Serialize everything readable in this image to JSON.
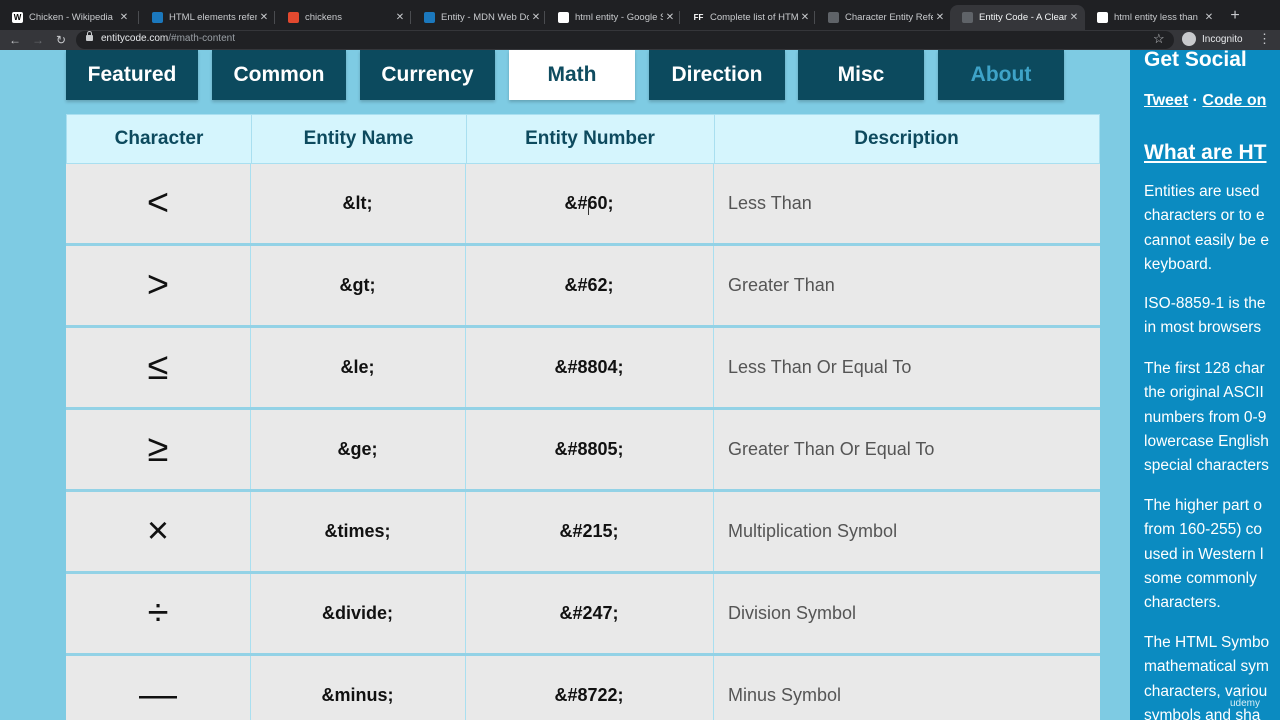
{
  "browser": {
    "tabs": [
      {
        "title": "Chicken - Wikipedia",
        "favicon": "W",
        "favicon_bg": "#ffffff",
        "favicon_color": "#000000",
        "active": false
      },
      {
        "title": "HTML elements reference",
        "favicon": "",
        "favicon_bg": "#1b78bd",
        "favicon_color": "#ffffff",
        "active": false
      },
      {
        "title": "chickens",
        "favicon": "",
        "favicon_bg": "#e2492f",
        "favicon_color": "#ffffff",
        "active": false
      },
      {
        "title": "Entity - MDN Web Docs",
        "favicon": "",
        "favicon_bg": "#1b78bd",
        "favicon_color": "#ffffff",
        "active": false
      },
      {
        "title": "html entity - Google Search",
        "favicon": "",
        "favicon_bg": "#ffffff",
        "favicon_color": "#4285f4",
        "active": false
      },
      {
        "title": "Complete list of HTML",
        "favicon": "FF",
        "favicon_bg": "#1f2023",
        "favicon_color": "#ffffff",
        "active": false
      },
      {
        "title": "Character Entity Reference",
        "favicon": "",
        "favicon_bg": "#5f6368",
        "favicon_color": "#ffffff",
        "active": false
      },
      {
        "title": "Entity Code - A Clean",
        "favicon": "",
        "favicon_bg": "#5f6368",
        "favicon_color": "#ffffff",
        "active": true
      },
      {
        "title": "html entity less than",
        "favicon": "",
        "favicon_bg": "#ffffff",
        "favicon_color": "#4285f4",
        "active": false
      }
    ],
    "new_tab": "+",
    "url_host": "entitycode.com",
    "url_path": "/#math-content",
    "incognito_label": "Incognito"
  },
  "nav": {
    "items": [
      {
        "label": "Featured",
        "active": false
      },
      {
        "label": "Common",
        "active": false
      },
      {
        "label": "Currency",
        "active": false
      },
      {
        "label": "Math",
        "active": true
      },
      {
        "label": "Direction",
        "active": false
      },
      {
        "label": "Misc",
        "active": false
      },
      {
        "label": "About",
        "active": false
      }
    ]
  },
  "table": {
    "headers": [
      "Character",
      "Entity Name",
      "Entity Number",
      "Description"
    ],
    "rows": [
      {
        "char": "<",
        "name": "&lt;",
        "number": "&#60;",
        "desc": "Less Than"
      },
      {
        "char": ">",
        "name": "&gt;",
        "number": "&#62;",
        "desc": "Greater Than"
      },
      {
        "char": "≤",
        "name": "&le;",
        "number": "&#8804;",
        "desc": "Less Than Or Equal To"
      },
      {
        "char": "≥",
        "name": "&ge;",
        "number": "&#8805;",
        "desc": "Greater Than Or Equal To"
      },
      {
        "char": "×",
        "name": "&times;",
        "number": "&#215;",
        "desc": "Multiplication Symbol"
      },
      {
        "char": "÷",
        "name": "&divide;",
        "number": "&#247;",
        "desc": "Division Symbol"
      },
      {
        "char": "—",
        "name": "&minus;",
        "number": "&#8722;",
        "desc": "Minus Symbol"
      }
    ]
  },
  "sidebar": {
    "get_social": "Get Social",
    "tweet": "Tweet",
    "dot": "·",
    "code_on": "Code on",
    "what_title": "What are HT",
    "paragraphs": [
      [
        "Entities are used",
        "characters or to e",
        "cannot easily be e",
        "keyboard."
      ],
      [
        "ISO-8859-1 is the",
        "in most browsers"
      ],
      [
        "The first 128 char",
        "the original ASCII",
        "numbers from 0-9",
        "lowercase English",
        "special characters"
      ],
      [
        "The higher part o",
        "from 160-255) co",
        "used in Western l",
        "some commonly",
        "characters."
      ],
      [
        "The HTML Symbo",
        "mathematical sym",
        "characters, variou",
        "symbols and sha"
      ]
    ]
  },
  "watermark": "udemy"
}
